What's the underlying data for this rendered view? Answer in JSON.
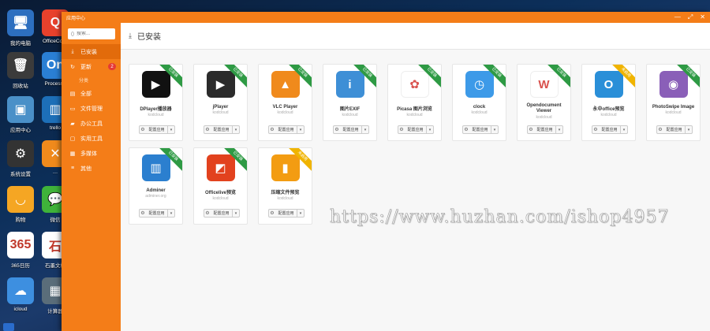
{
  "desktop": {
    "icons": [
      {
        "label": "我的电脑",
        "icon": "computer-icon",
        "color": "#2d6fbf",
        "glyph": "🖥"
      },
      {
        "label": "OfficeConv",
        "icon": "office-convert-icon",
        "color": "#e8412c",
        "glyph": "Q"
      },
      {
        "label": "回收站",
        "icon": "recycle-bin-icon",
        "color": "#3b3b3b",
        "glyph": "🗑"
      },
      {
        "label": "Processo",
        "icon": "processon-icon",
        "color": "#2a7fd4",
        "glyph": "On"
      },
      {
        "label": "应用中心",
        "icon": "app-center-icon",
        "color": "#4a90c8",
        "glyph": "▣"
      },
      {
        "label": "trello",
        "icon": "trello-icon",
        "color": "#1d6fb8",
        "glyph": "▥"
      },
      {
        "label": "系统设置",
        "icon": "settings-gear-icon",
        "color": "#333333",
        "glyph": "⚙"
      },
      {
        "label": "…",
        "icon": "xmind-icon",
        "color": "#f08a1c",
        "glyph": "✕"
      },
      {
        "label": "购物",
        "icon": "shopping-icon",
        "color": "#f5a623",
        "glyph": "◡"
      },
      {
        "label": "微信",
        "icon": "wechat-icon",
        "color": "#3fb33a",
        "glyph": "💬"
      },
      {
        "label": "365日历",
        "icon": "calendar-365-icon",
        "color": "#ffffff",
        "glyph": "365"
      },
      {
        "label": "石墨文档",
        "icon": "shimo-icon",
        "color": "#ffffff",
        "glyph": "石"
      },
      {
        "label": "icloud",
        "icon": "icloud-icon",
        "color": "#3d8fe0",
        "glyph": "☁"
      },
      {
        "label": "计算器",
        "icon": "calculator-icon",
        "color": "#5a6d7a",
        "glyph": "▦"
      }
    ]
  },
  "window": {
    "title": "应用中心",
    "controls": [
      "—",
      "⤢",
      "✕"
    ]
  },
  "sidebar": {
    "search_placeholder": "搜索...",
    "items": [
      {
        "label": "已安装",
        "icon": "download-icon",
        "glyph": "⤓",
        "active": true
      },
      {
        "label": "更新",
        "icon": "refresh-icon",
        "glyph": "↻",
        "badge": "2"
      },
      {
        "label": "分类",
        "sub": true
      },
      {
        "label": "全部",
        "icon": "all-icon",
        "glyph": "▤"
      },
      {
        "label": "文件管理",
        "icon": "folder-icon",
        "glyph": "▭"
      },
      {
        "label": "办公工具",
        "icon": "briefcase-icon",
        "glyph": "▰"
      },
      {
        "label": "实用工具",
        "icon": "tools-icon",
        "glyph": "▢"
      },
      {
        "label": "多媒体",
        "icon": "media-icon",
        "glyph": "▦"
      },
      {
        "label": "其他",
        "icon": "more-icon",
        "glyph": "≡"
      }
    ]
  },
  "main": {
    "heading": "已安装",
    "heading_icon": "download-icon"
  },
  "apps": [
    {
      "name": "DPlayer播放器",
      "author": "kodcloud",
      "status": "已安装",
      "ribbon": "green",
      "icon": "play-icon",
      "bg": "#111111",
      "glyph": "▶",
      "button": "配置应用"
    },
    {
      "name": "jPlayer",
      "author": "kodcloud",
      "status": "已安装",
      "ribbon": "green",
      "icon": "clapper-icon",
      "bg": "#2b2b2b",
      "glyph": "▶",
      "button": "配置应用"
    },
    {
      "name": "VLC Player",
      "author": "kodcloud",
      "status": "已安装",
      "ribbon": "green",
      "icon": "vlc-cone-icon",
      "bg": "#f08a1c",
      "glyph": "▲",
      "button": "配置应用"
    },
    {
      "name": "图片EXIF",
      "author": "kodcloud",
      "status": "已安装",
      "ribbon": "green",
      "icon": "info-icon",
      "bg": "#3e8fd6",
      "glyph": "i",
      "button": "配置应用"
    },
    {
      "name": "Picasa 图片浏览",
      "author": "kodcloud",
      "status": "已安装",
      "ribbon": "green",
      "icon": "photos-flower-icon",
      "bg": "#ffffff",
      "glyph": "✿",
      "button": "配置应用"
    },
    {
      "name": "clock",
      "author": "kodcloud",
      "status": "已安装",
      "ribbon": "green",
      "icon": "clock-icon",
      "bg": "#3d9ae8",
      "glyph": "◷",
      "button": "配置应用"
    },
    {
      "name": "Opendocument Viewer",
      "author": "kodcloud",
      "status": "已安装",
      "ribbon": "green",
      "icon": "word-doc-icon",
      "bg": "#ffffff",
      "glyph": "W",
      "button": "配置应用"
    },
    {
      "name": "永中office预览",
      "author": "kodcloud",
      "status": "未启用",
      "ribbon": "yellow",
      "icon": "yozo-office-icon",
      "bg": "#2a8fd8",
      "glyph": "O",
      "button": "配置应用"
    },
    {
      "name": "PhotoSwipe Image",
      "author": "kodcloud",
      "status": "已安装",
      "ribbon": "green",
      "icon": "balloon-photo-icon",
      "bg": "#8a5fb8",
      "glyph": "◉",
      "button": "配置应用"
    },
    {
      "name": "Adminer",
      "author": "adminer.org",
      "status": "已安装",
      "ribbon": "green",
      "icon": "bar-chart-icon",
      "bg": "#2b7fcf",
      "glyph": "▥",
      "button": "配置应用"
    },
    {
      "name": "Officelive预览",
      "author": "kodcloud",
      "status": "已安装",
      "ribbon": "green",
      "icon": "office-icon",
      "bg": "#e2421e",
      "glyph": "◩",
      "button": "配置应用"
    },
    {
      "name": "压缩文件预览",
      "author": "kodcloud",
      "status": "未启用",
      "ribbon": "yellow",
      "icon": "zip-icon",
      "bg": "#f39c12",
      "glyph": "▮",
      "button": "配置应用"
    }
  ],
  "watermark": "https://www.huzhan.com/ishop4957"
}
